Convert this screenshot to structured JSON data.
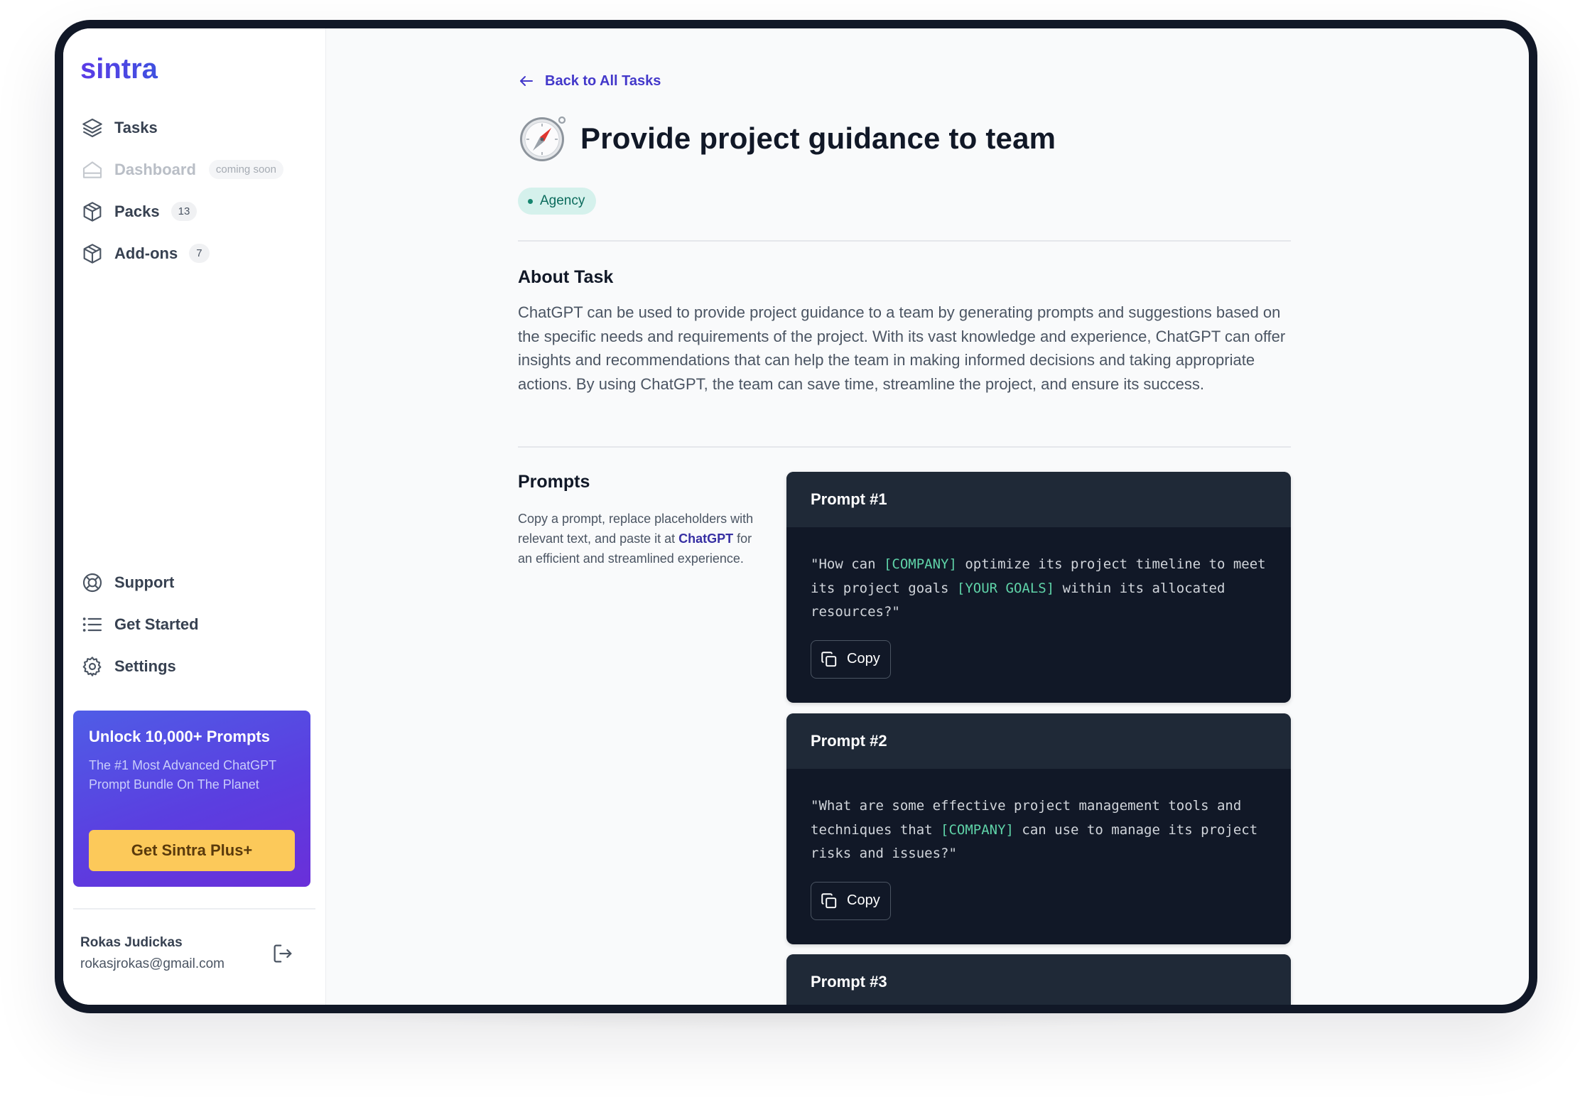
{
  "app": {
    "logo_text": "sintra",
    "brand_color": "#4f3fe0"
  },
  "sidebar": {
    "items": [
      {
        "label": "Tasks",
        "icon": "layers-icon"
      },
      {
        "label": "Dashboard",
        "icon": "home-icon",
        "badge": "coming soon",
        "disabled": true
      },
      {
        "label": "Packs",
        "icon": "box-icon",
        "badge": "13"
      },
      {
        "label": "Add-ons",
        "icon": "box-icon",
        "badge": "7"
      }
    ],
    "bottom_items": [
      {
        "label": "Support",
        "icon": "lifebuoy-icon"
      },
      {
        "label": "Get Started",
        "icon": "list-icon"
      },
      {
        "label": "Settings",
        "icon": "gear-icon"
      }
    ],
    "promo": {
      "title": "Unlock 10,000+ Prompts",
      "text": "The #1 Most Advanced ChatGPT Prompt Bundle On The Planet",
      "button": "Get Sintra Plus+"
    },
    "user": {
      "name": "Rokas Judickas",
      "email": "rokasjrokas@gmail.com"
    }
  },
  "main": {
    "back_label": "Back to All Tasks",
    "title": "Provide project guidance to team",
    "tag": "Agency",
    "about": {
      "heading": "About Task",
      "text": "ChatGPT can be used to provide project guidance to a team by generating prompts and suggestions based on the specific needs and requirements of the project. With its vast knowledge and experience, ChatGPT can offer insights and recommendations that can help the team in making informed decisions and taking appropriate actions. By using ChatGPT, the team can save time, streamline the project, and ensure its success."
    },
    "prompts": {
      "heading": "Prompts",
      "description_before": "Copy a prompt, replace placeholders with relevant text, and paste it at ",
      "description_link": "ChatGPT",
      "description_after": " for an efficient and streamlined experience.",
      "copy_label": "Copy",
      "items": [
        {
          "title": "Prompt #1",
          "parts": [
            {
              "t": "\"How can "
            },
            {
              "t": "[COMPANY]",
              "ph": true
            },
            {
              "t": " optimize its project timeline to meet its project goals "
            },
            {
              "t": "[YOUR GOALS]",
              "ph": true
            },
            {
              "t": " within its allocated resources?\""
            }
          ]
        },
        {
          "title": "Prompt #2",
          "parts": [
            {
              "t": "\"What are some effective project management tools and techniques that "
            },
            {
              "t": "[COMPANY]",
              "ph": true
            },
            {
              "t": " can use to manage its project risks and issues?\""
            }
          ]
        },
        {
          "title": "Prompt #3",
          "parts": []
        }
      ]
    }
  }
}
